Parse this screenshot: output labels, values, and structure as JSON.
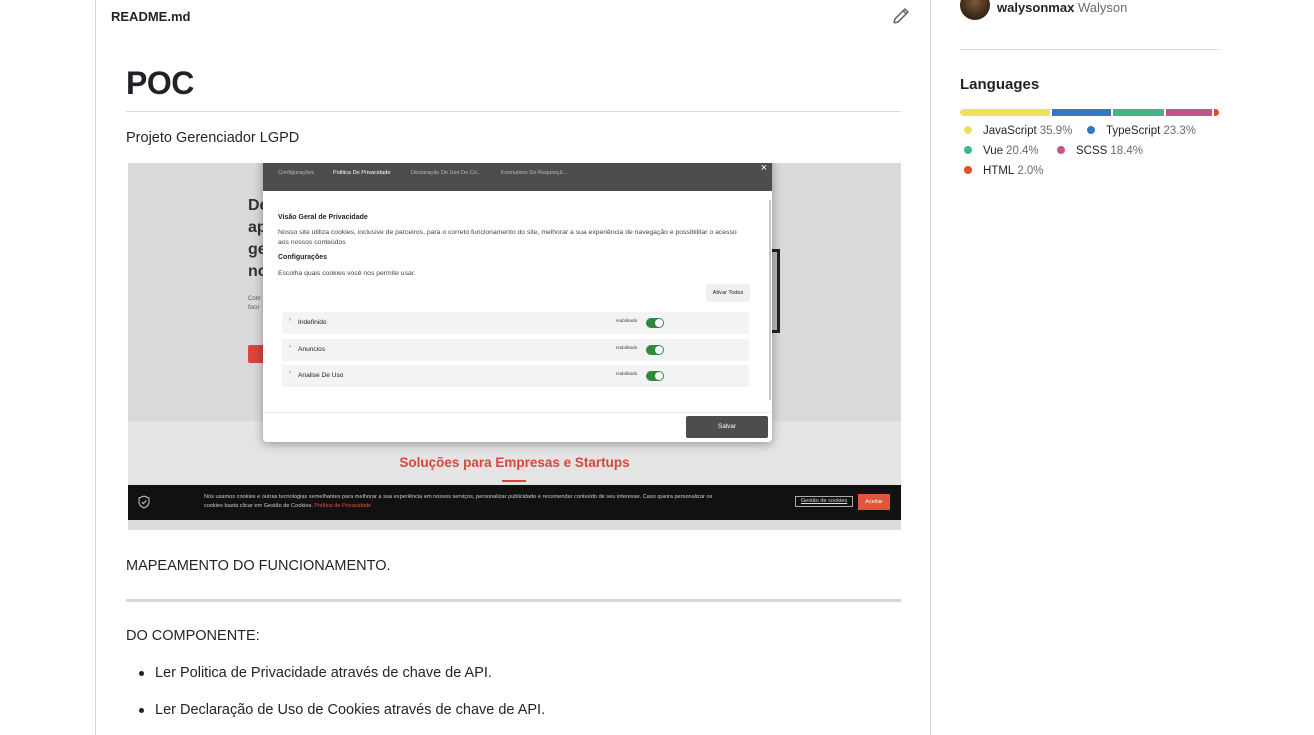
{
  "readme": {
    "filename": "README.md",
    "title": "POC",
    "subtitle": "Projeto Gerenciador LGPD",
    "mapping": "MAPEAMENTO DO FUNCIONAMENTO.",
    "component_heading": "DO COMPONENTE:",
    "list": [
      "Ler Politica de Privacidade através de chave de API.",
      "Ler Declaração de Uso de Cookies através de chave de API."
    ]
  },
  "screenshot": {
    "modal": {
      "tabs": [
        "Configurações",
        "Politica De Privacidade",
        "Declaração De Uso De Co...",
        "Formulário De Requisiçã..."
      ],
      "close": "×",
      "heading1": "Visão Geral de Privacidade",
      "paragraph1": "Nosso site utiliza cookies, inclusive de parceiros, para o correto funcionamento do site, melhorar a sua experiência de navegação e possibilitar o acesso aos nossos conteúdos",
      "heading2": "Configurações",
      "paragraph2": "Escolha quais cookies você nos permite usar.",
      "ativar_todos": "Ativar Todos",
      "rows": [
        {
          "label": "Indefinido",
          "status": "Habilitado"
        },
        {
          "label": "Anuncios",
          "status": "Habilitado"
        },
        {
          "label": "Analise De Uso",
          "status": "Habilitado"
        }
      ],
      "save": "Salvar"
    },
    "hero_letters": "De ap ge no",
    "hero_small": "Com foco",
    "solutions": "Soluções para Empresas e Startups",
    "cookie_bar": {
      "text": "Nós usamos cookies e outras tecnologias semelhantes para melhorar a sua experiência em nossos serviços, personalizar publicidade e recomendar conteúdo de seu interesse. Caso queira personalizar os cookies basta clicar em Gestão de Cookies.",
      "link": "Política de Privacidade",
      "manage": "Gestão de cookies",
      "accept": "Aceitar"
    }
  },
  "sidebar": {
    "contributor_login": "walysonmax",
    "contributor_name": "Walyson",
    "languages_title": "Languages",
    "languages": [
      {
        "name": "JavaScript",
        "percent": "35.9%",
        "value": 35.9,
        "color": "#f1e05a"
      },
      {
        "name": "TypeScript",
        "percent": "23.3%",
        "value": 23.3,
        "color": "#3178c6"
      },
      {
        "name": "Vue",
        "percent": "20.4%",
        "value": 20.4,
        "color": "#41b883"
      },
      {
        "name": "SCSS",
        "percent": "18.4%",
        "value": 18.4,
        "color": "#c6538c"
      },
      {
        "name": "HTML",
        "percent": "2.0%",
        "value": 2.0,
        "color": "#e34c26"
      }
    ]
  }
}
